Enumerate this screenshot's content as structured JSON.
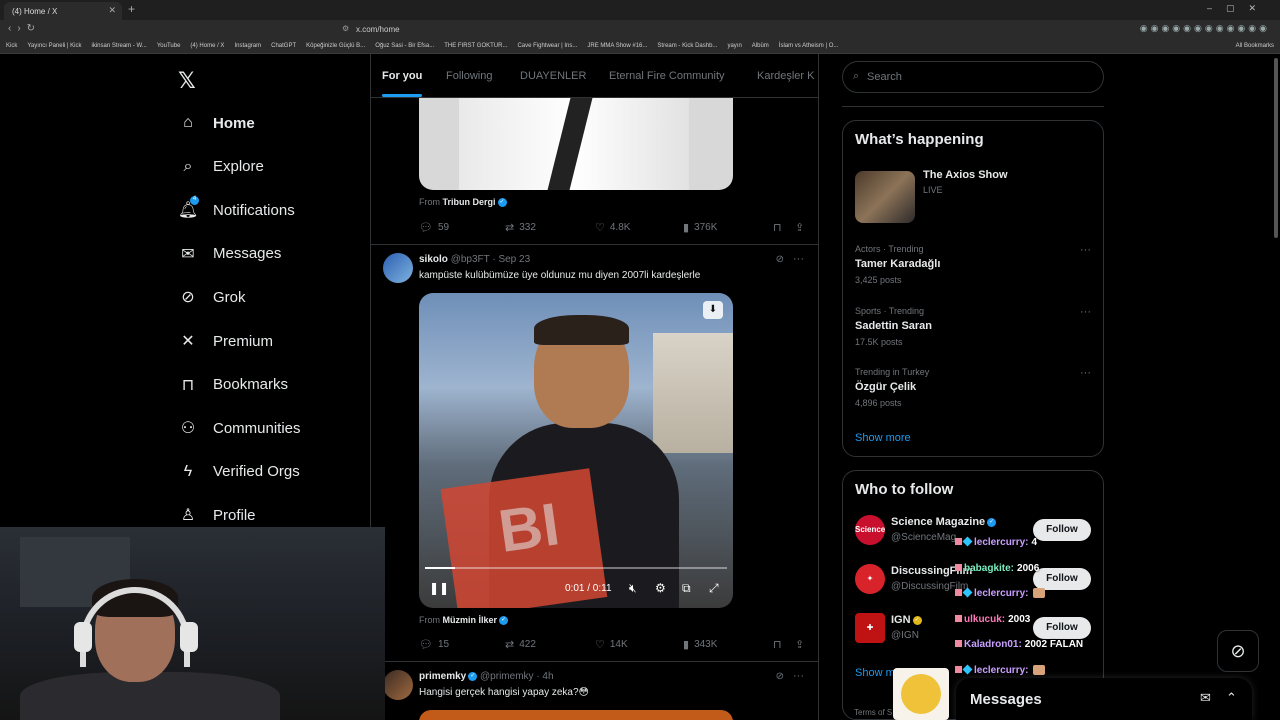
{
  "browser": {
    "tab_title": "(4) Home / X",
    "url": "x.com/home",
    "bookmarks": [
      "Kick",
      "Yayıncı Paneli | Kick",
      "ikinsan Stream - W...",
      "YouTube",
      "(4) Home / X",
      "Instagram",
      "ChatGPT",
      "Köpeğinizle Güçlü B...",
      "Oğuz Sasi - Bir Efsa...",
      "THE FIRST GOKTUR...",
      "Cave Fightwear | Ins...",
      "JRE MMA Show #16...",
      "Stream - Kick Dashb...",
      "yayın",
      "Albüm",
      "İslam vs Atheism | O..."
    ],
    "all_bookmarks": "All Bookmarks"
  },
  "nav": {
    "items": [
      {
        "label": "Home",
        "icon": "home-icon"
      },
      {
        "label": "Explore",
        "icon": "search-icon"
      },
      {
        "label": "Notifications",
        "icon": "bell-icon"
      },
      {
        "label": "Messages",
        "icon": "envelope-icon"
      },
      {
        "label": "Grok",
        "icon": "grok-icon"
      },
      {
        "label": "Premium",
        "icon": "x-logo-icon"
      },
      {
        "label": "Bookmarks",
        "icon": "bookmark-icon"
      },
      {
        "label": "Communities",
        "icon": "people-icon"
      },
      {
        "label": "Verified Orgs",
        "icon": "lightning-icon"
      },
      {
        "label": "Profile",
        "icon": "person-icon"
      }
    ],
    "notification_count": "4"
  },
  "home_tabs": [
    "For you",
    "Following",
    "DUAYENLER",
    "Eternal Fire Community",
    "Kardeşler K"
  ],
  "feed": {
    "tweet0": {
      "from_prefix": "From",
      "from_name": "Tribun Dergi",
      "replies": "59",
      "reposts": "332",
      "likes": "4.8K",
      "views": "376K"
    },
    "tweet1": {
      "name": "sikolo",
      "handle": "@bp3FT",
      "date": "· Sep 23",
      "text": "kampüste kulübümüze üye oldunuz mu diyen 2007li kardeşlerle",
      "video_time": "0:01 / 0:11",
      "video_progress": 0.1,
      "video_overlay_text": "BI",
      "from_prefix": "From",
      "from_name": "Müzmin İlker",
      "replies": "15",
      "reposts": "422",
      "likes": "14K",
      "views": "343K"
    },
    "tweet2": {
      "name": "primemky",
      "handle": "@primemky",
      "date": "· 4h",
      "text": "Hangisi gerçek hangisi yapay zeka?😳"
    }
  },
  "search": {
    "placeholder": "Search"
  },
  "whats_happening": {
    "title": "What’s happening",
    "live_title": "The Axios Show",
    "live_label": "LIVE",
    "trends": [
      {
        "meta": "Actors · Trending",
        "name": "Tamer Karadağlı",
        "posts": "3,425 posts"
      },
      {
        "meta": "Sports · Trending",
        "name": "Sadettin Saran",
        "posts": "17.5K posts"
      },
      {
        "meta": "Trending in Turkey",
        "name": "Özgür Çelik",
        "posts": "4,896 posts"
      }
    ],
    "show_more": "Show more"
  },
  "who_to_follow": {
    "title": "Who to follow",
    "accounts": [
      {
        "name": "Science Magazine",
        "handle": "@ScienceMag",
        "avatar_text": "Science",
        "color": "#c8102e"
      },
      {
        "name": "DiscussingFilm",
        "handle": "@DiscussingFilm",
        "avatar_text": "",
        "color": "#d8232a"
      },
      {
        "name": "IGN",
        "handle": "@IGN",
        "avatar_text": "",
        "color": "#bf1313"
      }
    ],
    "follow_label": "Follow",
    "show_more": "Show more"
  },
  "stream_chat": [
    {
      "user": "leclercurry:",
      "msg": "4",
      "color": "#c9a0ff"
    },
    {
      "user": "babagkite:",
      "msg": "2006",
      "color": "#7cf0c0"
    },
    {
      "user": "leclercurry:",
      "msg": "",
      "color": "#c9a0ff"
    },
    {
      "user": "ulkucuk:",
      "msg": "2003",
      "color": "#ff7ab8"
    },
    {
      "user": "Kaladron01:",
      "msg": "2002 FALAN",
      "color": "#c9a0ff"
    },
    {
      "user": "leclercurry:",
      "msg": "",
      "color": "#c9a0ff"
    }
  ],
  "messages_dock": {
    "title": "Messages"
  },
  "footer": {
    "terms": "Terms of S"
  }
}
